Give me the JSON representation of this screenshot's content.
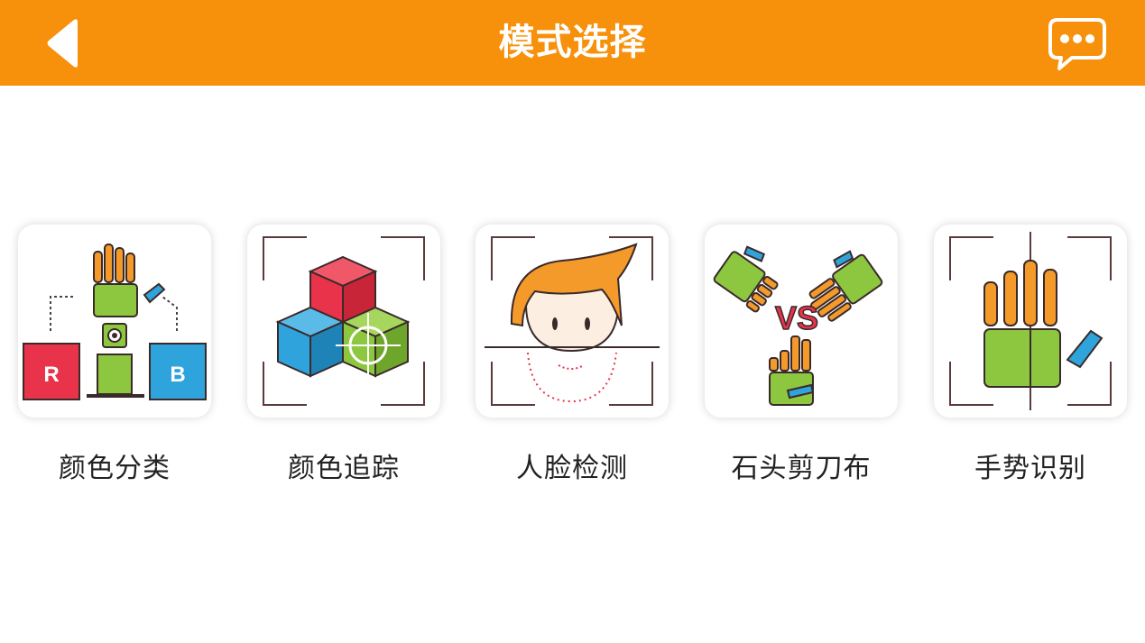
{
  "header": {
    "title": "模式选择",
    "bg_color": "#f7900a",
    "back_icon": "back-arrow-icon",
    "menu_icon": "chat-bubble-icon"
  },
  "modes": [
    {
      "label": "颜色分类",
      "icon": "color-sort-icon",
      "block_left": "R",
      "block_right": "B"
    },
    {
      "label": "颜色追踪",
      "icon": "color-tracking-icon"
    },
    {
      "label": "人脸检测",
      "icon": "face-detection-icon"
    },
    {
      "label": "石头剪刀布",
      "icon": "rock-paper-scissors-icon",
      "vs": "VS"
    },
    {
      "label": "手势识别",
      "icon": "gesture-recognition-icon"
    }
  ],
  "colors": {
    "red": "#e8334a",
    "green": "#8dc63f",
    "blue": "#2fa3dc",
    "orange": "#f39a2b",
    "outline": "#3a2a2a"
  }
}
